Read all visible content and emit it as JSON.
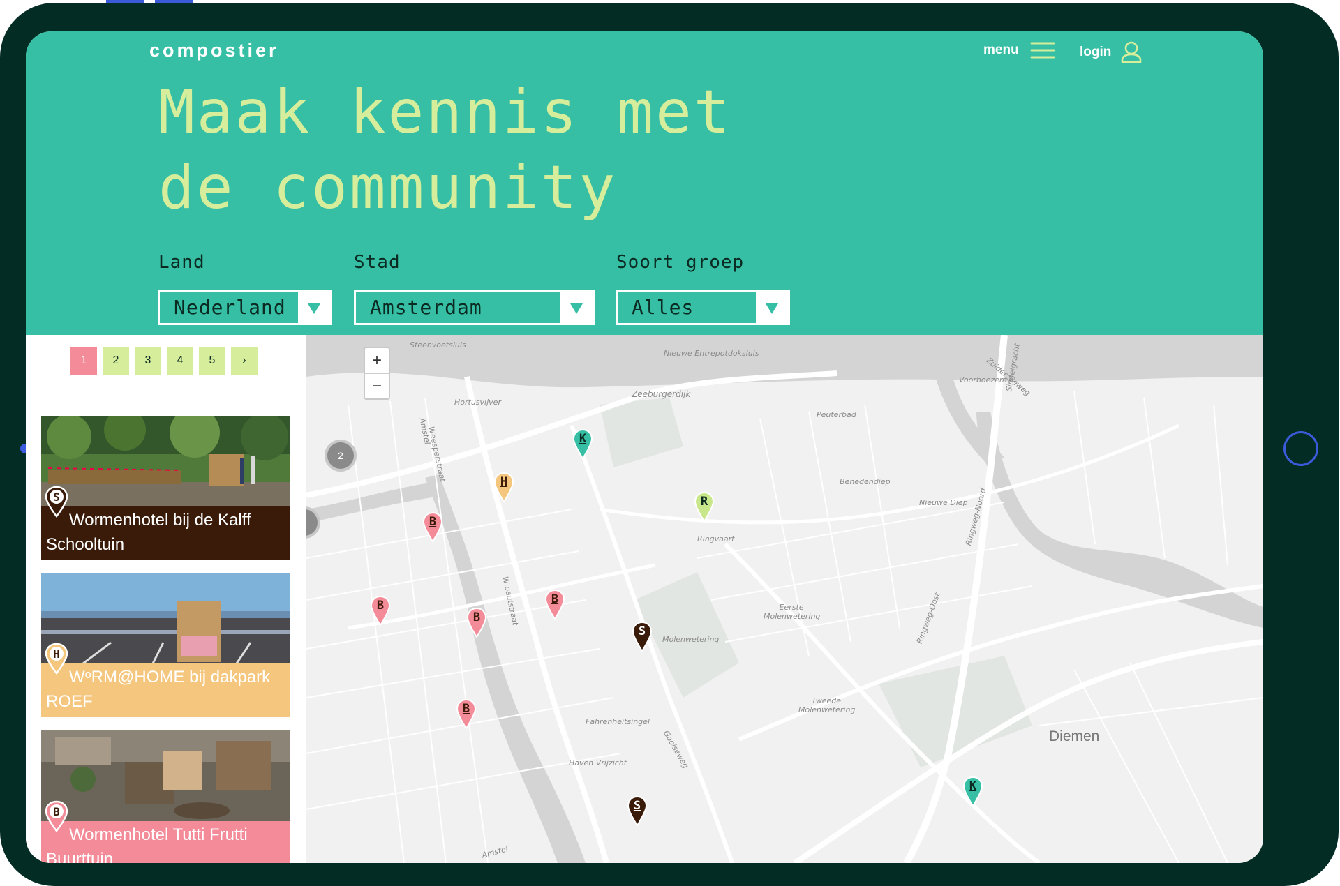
{
  "brand": {
    "logo": "compostier"
  },
  "nav": {
    "menu_label": "menu",
    "login_label": "login"
  },
  "hero": {
    "line1": "Maak kennis met",
    "line2": "de community"
  },
  "filters": {
    "land": {
      "label": "Land",
      "value": "Nederland"
    },
    "stad": {
      "label": "Stad",
      "value": "Amsterdam"
    },
    "soort": {
      "label": "Soort groep",
      "value": "Alles"
    }
  },
  "pagination": {
    "pages": [
      "1",
      "2",
      "3",
      "4",
      "5"
    ],
    "active": "1",
    "next": "›"
  },
  "cards": [
    {
      "letter": "S",
      "line1": "Wormenhotel bij de Kalff",
      "line2": "Schooltuin",
      "color": "#3a1a08"
    },
    {
      "letter": "H",
      "line1": "WᵒRM@HOME bij dakpark",
      "line2": "ROEF",
      "color": "#f5c77e"
    },
    {
      "letter": "B",
      "line1": "Wormenhotel Tutti Frutti",
      "line2": "Buurttuin",
      "color": "#f48b98"
    }
  ],
  "map": {
    "zoom_in": "+",
    "zoom_out": "−",
    "clusters": [
      "2"
    ],
    "place_label": "Diemen",
    "street_labels": [
      "Steenvoetsluis",
      "Nieuwe Entrepotdoksluis",
      "Zeeburgerdijk",
      "Voorboezem",
      "Peuterbad",
      "Benedendiep",
      "Nieuwe Diep",
      "Hortusvijver",
      "Weesperstraat",
      "Amstel",
      "Wibautstraat",
      "Ringvaart",
      "Molenwetering",
      "Eerste Molenwetering",
      "Tweede Molenwetering",
      "Fahrenheitsingel",
      "Haven Vrijzicht",
      "Gooiseweg",
      "Ringweg-Oost",
      "Ringweg-Noord",
      "Zuiderzeeweg",
      "Singelgracht",
      "Amstel"
    ],
    "markers": [
      "K",
      "H",
      "R",
      "B",
      "B",
      "B",
      "B",
      "S",
      "B",
      "S",
      "K"
    ]
  },
  "colors": {
    "header": "#36bfa4",
    "hero_text": "#d6ee9c",
    "frame": "#032c25",
    "pink": "#f48b98",
    "orange": "#f5c77e",
    "brown": "#3a1a08",
    "teal_pin": "#36bfa4",
    "lime_pin": "#c8e68a"
  }
}
